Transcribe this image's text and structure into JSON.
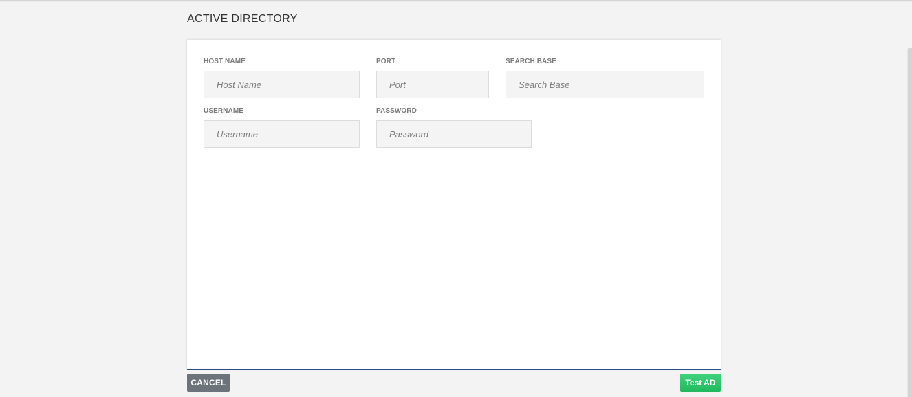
{
  "page": {
    "title": "ACTIVE DIRECTORY"
  },
  "form": {
    "host_name": {
      "label": "HOST NAME",
      "placeholder": "Host Name",
      "value": ""
    },
    "port": {
      "label": "PORT",
      "placeholder": "Port",
      "value": ""
    },
    "search_base": {
      "label": "SEARCH BASE",
      "placeholder": "Search Base",
      "value": ""
    },
    "username": {
      "label": "USERNAME",
      "placeholder": "Username",
      "value": ""
    },
    "password": {
      "label": "PASSWORD",
      "placeholder": "Password",
      "value": ""
    }
  },
  "footer": {
    "cancel_label": "CANCEL",
    "test_label": "Test AD"
  },
  "colors": {
    "page_background": "#f3f3f3",
    "card_accent_border": "#2b4f86",
    "cancel_button": "#6d737b",
    "test_button": "#2ecc71"
  }
}
